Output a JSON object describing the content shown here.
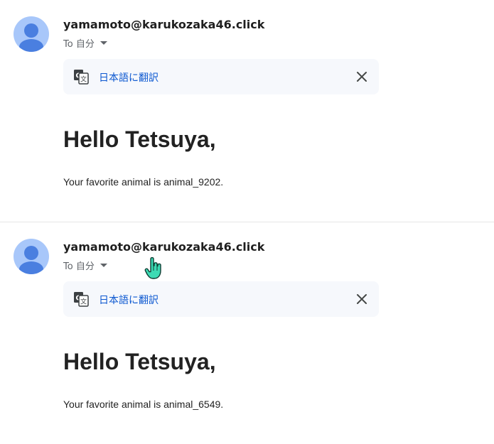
{
  "messages": [
    {
      "sender": "yamamoto@karukozaka46.click",
      "recipient_label": "To 自分",
      "translate_label": "日本語に翻訳",
      "greeting": "Hello Tetsuya,",
      "body": "Your favorite animal is animal_9202."
    },
    {
      "sender": "yamamoto@karukozaka46.click",
      "recipient_label": "To 自分",
      "translate_label": "日本語に翻訳",
      "greeting": "Hello Tetsuya,",
      "body": "Your favorite animal is animal_6549."
    }
  ],
  "icons": {
    "avatar": "person-avatar-icon",
    "translate": "google-translate-icon",
    "close": "close-icon",
    "caret": "caret-down-icon",
    "cursor": "hand-pointer-cursor-icon"
  },
  "colors": {
    "avatar_bg": "#a8c7fa",
    "avatar_fg": "#4a7fe0",
    "link": "#0b57d0",
    "translate_bar_bg": "#f6f8fc",
    "cursor_fill": "#3ddbb4"
  }
}
